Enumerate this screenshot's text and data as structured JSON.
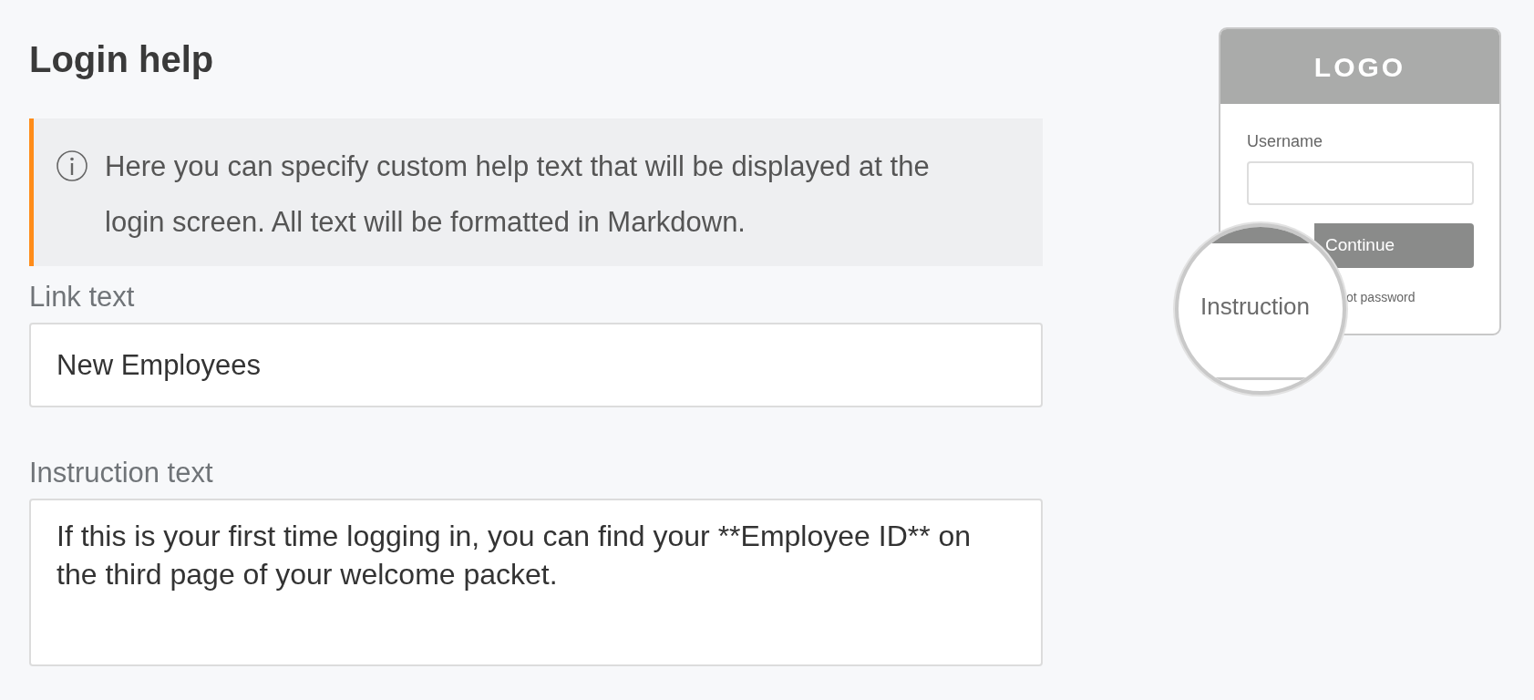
{
  "title": "Login help",
  "notice": {
    "text": "Here you can specify custom help text that will be displayed at the login screen. All text will be formatted in Markdown."
  },
  "fields": [
    {
      "label": "Link text",
      "value": "New Employees",
      "kind": "input"
    },
    {
      "label": "Instruction text",
      "value": "If this is your first time logging in, you can find your **Employee ID** on the third page of your welcome packet.",
      "kind": "textarea"
    }
  ],
  "preview": {
    "logo": "LOGO",
    "username_label": "Username",
    "button": "Continue",
    "forgot_link": "ot password",
    "magnifier_text": "Instruction"
  }
}
